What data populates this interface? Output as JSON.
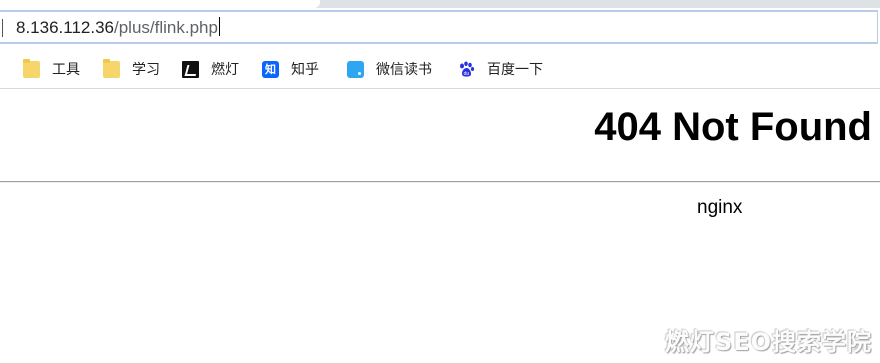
{
  "browser": {
    "url_host": "8.136.112.36",
    "url_path": "/plus/flink.php",
    "bookmarks": [
      {
        "label": "工具",
        "icon": "folder-icon"
      },
      {
        "label": "学习",
        "icon": "folder-icon"
      },
      {
        "label": "燃灯",
        "icon": "ranfeng-icon"
      },
      {
        "label": "知乎",
        "icon": "zhihu-icon",
        "glyph": "知"
      },
      {
        "label": "微信读书",
        "icon": "weread-icon"
      },
      {
        "label": "百度一下",
        "icon": "baidu-icon"
      }
    ]
  },
  "page": {
    "heading": "404 Not Found",
    "server": "nginx"
  },
  "watermark": "燃灯SEO搜索学院",
  "colors": {
    "omnibox_border": "#b9cbe9",
    "folder": "#f6d66a",
    "zhihu": "#0a66ff",
    "weread": "#2ea7f2",
    "baidu": "#2932e1"
  }
}
